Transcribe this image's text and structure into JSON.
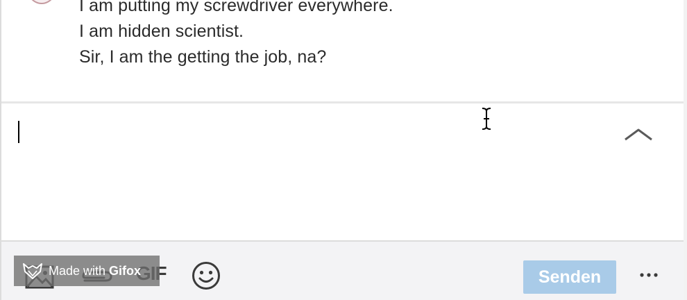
{
  "messages": {
    "lines": [
      "I am putting my screwdriver everywhere.",
      "I am hidden scientist.",
      "Sir, I am the getting the job, na?"
    ]
  },
  "compose": {
    "value": "",
    "placeholder": ""
  },
  "toolbar": {
    "gif_label": "GIF",
    "send_label": "Senden",
    "send_color": "#a9cbe8"
  },
  "watermark": {
    "text": "Made with",
    "brand": "Gifox"
  },
  "icons": {
    "image": "image-icon",
    "attach": "paperclip-icon",
    "emoji": "emoji-icon",
    "expand": "chevron-up-icon",
    "more": "more-horizontal-icon",
    "cursor": "text-cursor-icon"
  }
}
